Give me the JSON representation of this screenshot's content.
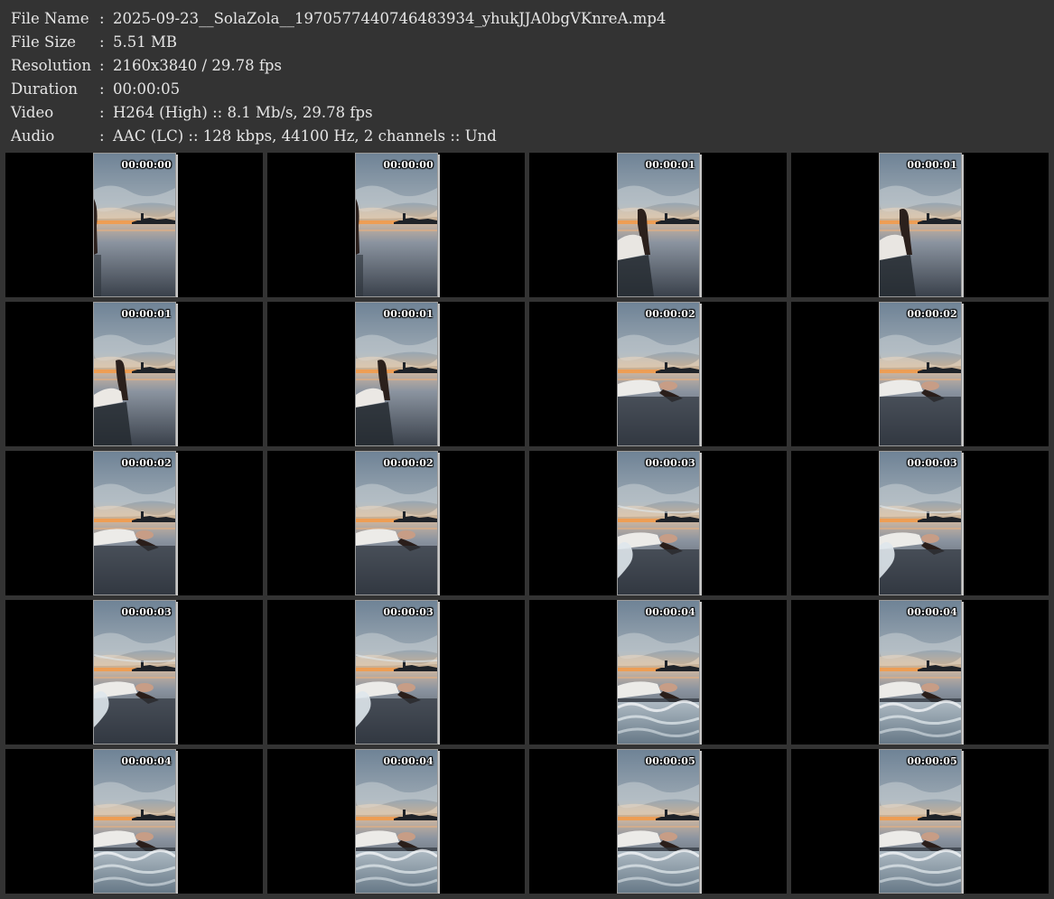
{
  "info": [
    {
      "label": "File Name",
      "value": "2025-09-23__SolaZola__1970577440746483934_yhukJJA0bgVKnreA.mp4"
    },
    {
      "label": "File Size",
      "value": "5.51 MB"
    },
    {
      "label": "Resolution",
      "value": "2160x3840 / 29.78 fps"
    },
    {
      "label": "Duration",
      "value": "00:00:05"
    },
    {
      "label": "Video",
      "value": "H264 (High) :: 8.1 Mb/s, 29.78 fps"
    },
    {
      "label": "Audio",
      "value": "AAC (LC) :: 128 kbps, 44100 Hz, 2 channels :: Und"
    }
  ],
  "separator": ":",
  "thumbnails": [
    {
      "timestamp": "00:00:00",
      "scene": "shore-edge"
    },
    {
      "timestamp": "00:00:00",
      "scene": "shore-edge"
    },
    {
      "timestamp": "00:00:01",
      "scene": "sitting"
    },
    {
      "timestamp": "00:00:01",
      "scene": "sitting"
    },
    {
      "timestamp": "00:00:01",
      "scene": "reclining"
    },
    {
      "timestamp": "00:00:01",
      "scene": "reclining"
    },
    {
      "timestamp": "00:00:02",
      "scene": "lying"
    },
    {
      "timestamp": "00:00:02",
      "scene": "lying"
    },
    {
      "timestamp": "00:00:02",
      "scene": "lying"
    },
    {
      "timestamp": "00:00:02",
      "scene": "lying"
    },
    {
      "timestamp": "00:00:03",
      "scene": "lying-wave"
    },
    {
      "timestamp": "00:00:03",
      "scene": "lying-wave"
    },
    {
      "timestamp": "00:00:03",
      "scene": "lying-wave"
    },
    {
      "timestamp": "00:00:03",
      "scene": "lying-wave"
    },
    {
      "timestamp": "00:00:04",
      "scene": "lying-surf"
    },
    {
      "timestamp": "00:00:04",
      "scene": "lying-surf"
    },
    {
      "timestamp": "00:00:04",
      "scene": "lying-surf"
    },
    {
      "timestamp": "00:00:04",
      "scene": "lying-surf"
    },
    {
      "timestamp": "00:00:05",
      "scene": "lying-surf"
    },
    {
      "timestamp": "00:00:05",
      "scene": "lying-surf"
    }
  ],
  "colors": {
    "background": "#333333",
    "cell": "#000000",
    "text": "#e6e6e6",
    "sky_top": "#7f93a6",
    "sunset": "#f2a25a",
    "water": "#5c6775"
  }
}
